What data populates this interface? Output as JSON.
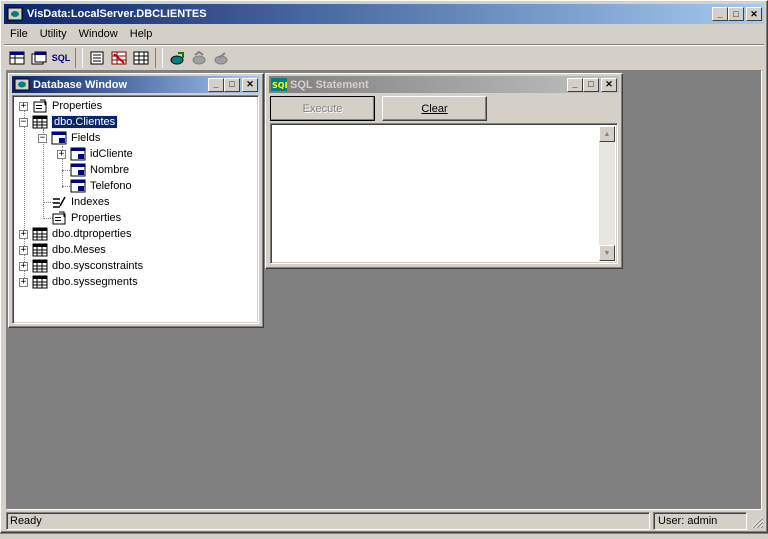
{
  "app": {
    "title": "VisData:LocalServer.DBCLIENTES",
    "min": "_",
    "max": "□",
    "close": "✕"
  },
  "menu": [
    "File",
    "Utility",
    "Window",
    "Help"
  ],
  "toolbar": {
    "icons": [
      "table-type-icon",
      "dynaset-type-icon",
      "sql-icon",
      "data-control-icon",
      "dbgrid-icon",
      "grid-icon",
      "begin-transaction-icon",
      "commit-icon",
      "rollback-icon"
    ],
    "sql_label": "SQL"
  },
  "database_window": {
    "title": "Database Window",
    "tree": [
      {
        "label": "Properties"
      },
      {
        "label": "dbo.Clientes"
      },
      {
        "label": "Fields"
      },
      {
        "label": "idCliente"
      },
      {
        "label": "Nombre"
      },
      {
        "label": "Telefono"
      },
      {
        "label": "Indexes"
      },
      {
        "label": "Properties"
      },
      {
        "label": "dbo.dtproperties"
      },
      {
        "label": "dbo.Meses"
      },
      {
        "label": "dbo.sysconstraints"
      },
      {
        "label": "dbo.syssegments"
      }
    ]
  },
  "sql_window": {
    "title": "SQL Statement",
    "execute_label": "Execute",
    "clear_label": "Clear",
    "text": ""
  },
  "status": {
    "left": "Ready",
    "right": "User: admin"
  },
  "colors": {
    "workspace": "#808080",
    "active_title": "#0a246a",
    "face": "#d4d0c8"
  }
}
